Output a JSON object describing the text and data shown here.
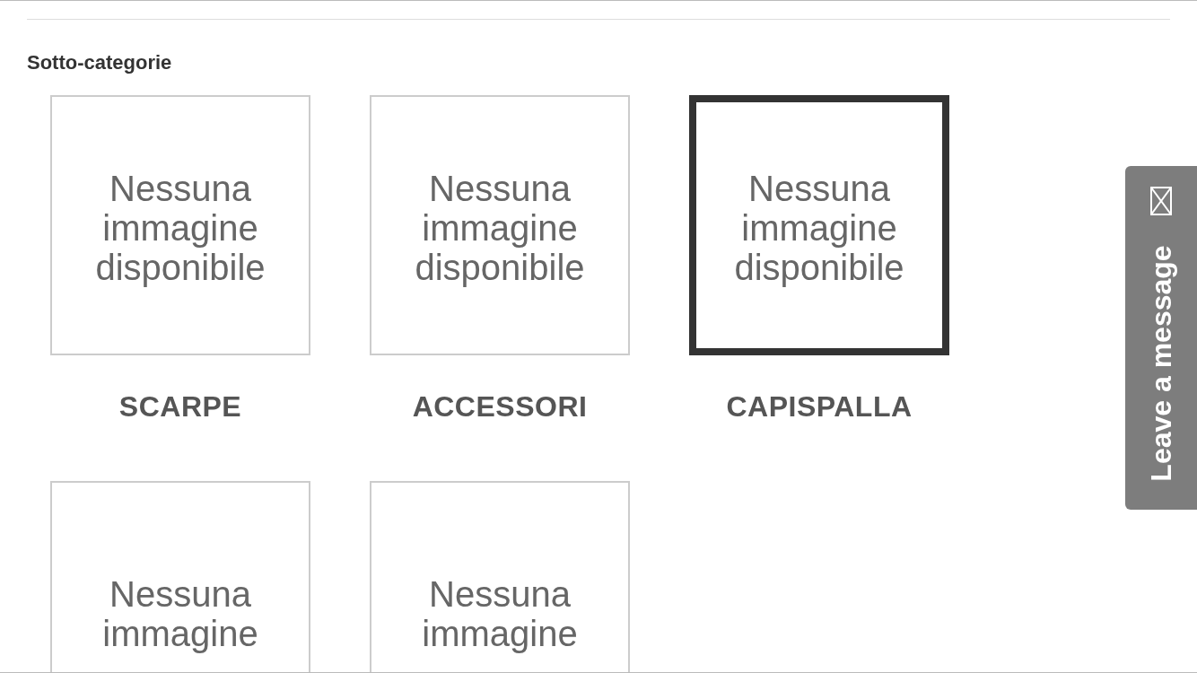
{
  "section": {
    "title": "Sotto-categorie"
  },
  "categories": [
    {
      "image_text": [
        "Nessuna",
        "immagine",
        "disponibile"
      ],
      "label": "SCARPE",
      "selected": false
    },
    {
      "image_text": [
        "Nessuna",
        "immagine",
        "disponibile"
      ],
      "label": "ACCESSORI",
      "selected": false
    },
    {
      "image_text": [
        "Nessuna",
        "immagine",
        "disponibile"
      ],
      "label": "CAPISPALLA",
      "selected": true
    },
    {
      "image_text": [
        "Nessuna",
        "immagine"
      ],
      "selected": false
    },
    {
      "image_text": [
        "Nessuna",
        "immagine"
      ],
      "selected": false
    }
  ],
  "message_tab": {
    "label": "Leave a message"
  }
}
